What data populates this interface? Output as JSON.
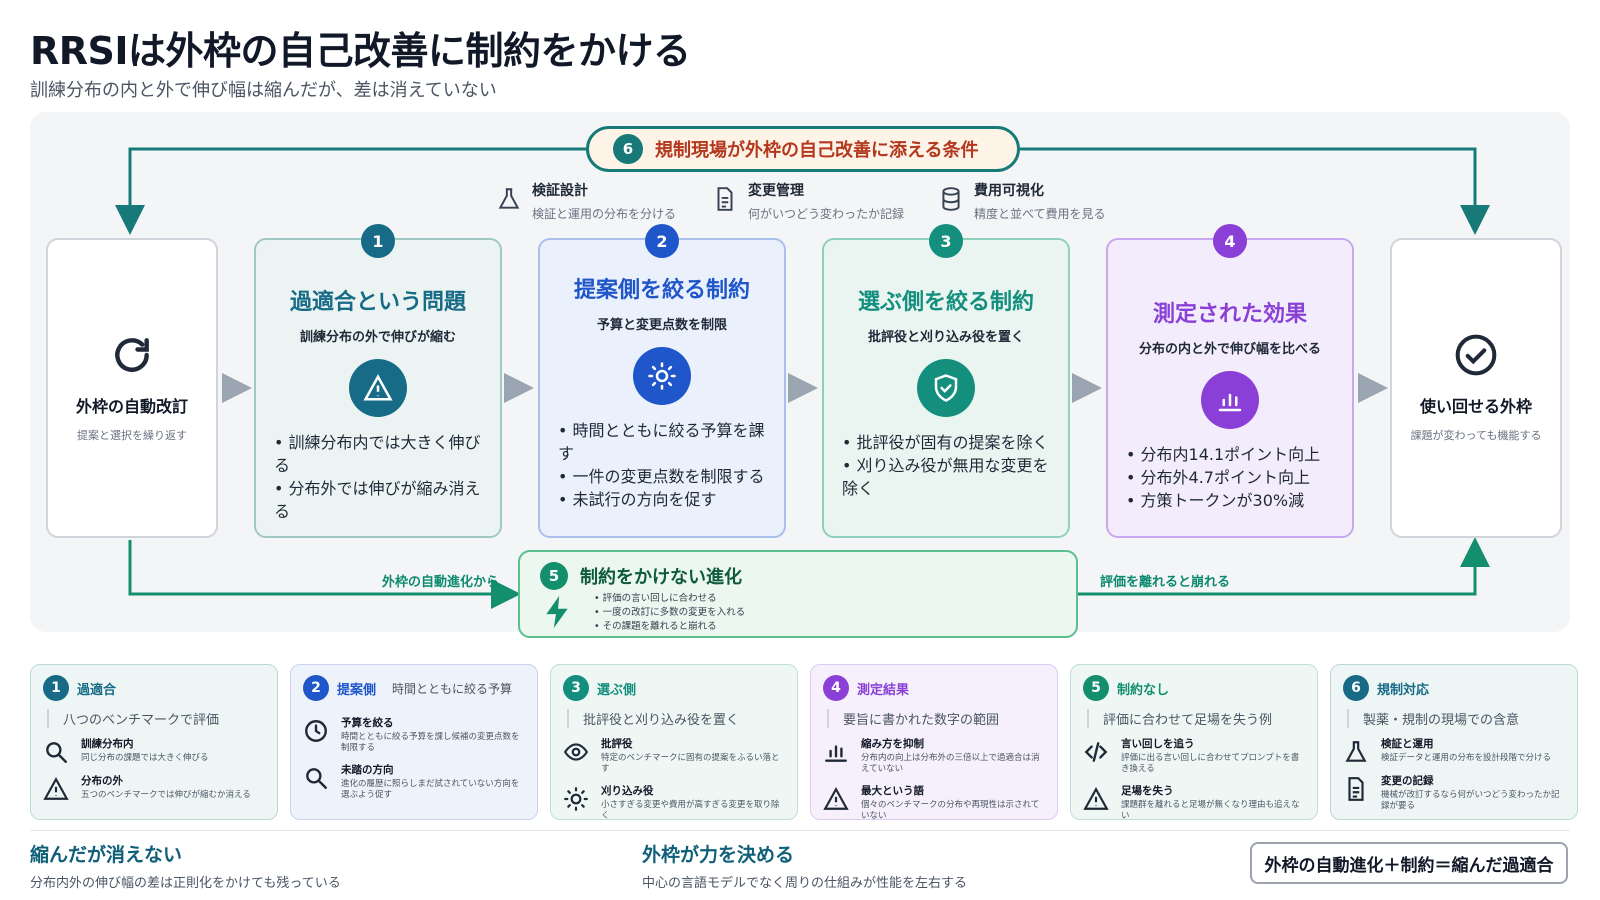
{
  "header": {
    "title": "RRSIは外枠の自己改善に制約をかける",
    "subtitle": "訓練分布の内と外で伸び幅は縮んだが、差は消えていない"
  },
  "banner": {
    "num": "6",
    "label": "規制現場が外枠の自己改善に添える条件"
  },
  "tools": [
    {
      "title": "検証設計",
      "desc": "検証と運用の分布を分ける",
      "icon": "flask-icon"
    },
    {
      "title": "変更管理",
      "desc": "何がいつどう変わったか記録",
      "icon": "document-icon"
    },
    {
      "title": "費用可視化",
      "desc": "精度と並べて費用を見る",
      "icon": "database-icon"
    }
  ],
  "left_node": {
    "title": "外枠の自動改訂",
    "desc": "提案と選択を繰り返す",
    "icon": "refresh-icon"
  },
  "right_node": {
    "title": "使い回せる外枠",
    "desc": "課題が変わっても機能する",
    "icon": "check-circle-icon"
  },
  "cards": [
    {
      "num": "1",
      "title": "過適合という問題",
      "subtitle": "訓練分布の外で伸びが縮む",
      "icon": "warning-icon",
      "color": "#176b87",
      "bullets": [
        "訓練分布内では大きく伸びる",
        "分布外では伸びが縮み消える"
      ]
    },
    {
      "num": "2",
      "title": "提案側を絞る制約",
      "subtitle": "予算と変更点数を制限",
      "icon": "sun-icon",
      "color": "#1f56c9",
      "bullets": [
        "時間とともに絞る予算を課す",
        "一件の変更点数を制限する",
        "未試行の方向を促す"
      ]
    },
    {
      "num": "3",
      "title": "選ぶ側を絞る制約",
      "subtitle": "批評役と刈り込み役を置く",
      "icon": "shield-check-icon",
      "color": "#148f7e",
      "bullets": [
        "批評役が固有の提案を除く",
        "刈り込み役が無用な変更を除く"
      ]
    },
    {
      "num": "4",
      "title": "測定された効果",
      "subtitle": "分布の内と外で伸び幅を比べる",
      "icon": "bar-chart-icon",
      "color": "#8a3fd6",
      "bullets": [
        "分布内14.1ポイント向上",
        "分布外4.7ポイント向上",
        "方策トークンが30%減"
      ]
    }
  ],
  "unconstrained": {
    "num": "5",
    "title": "制約をかけない進化",
    "icon": "bolt-icon",
    "bullets": [
      "評価の言い回しに合わせる",
      "一度の改訂に多数の変更を入れる",
      "その課題を離れると崩れる"
    ],
    "in_label": "外枠の自動進化から",
    "out_label": "評価を離れると崩れる"
  },
  "legend": [
    {
      "num": "1",
      "title": "過適合",
      "title2": "",
      "sub": "八つのベンチマークで評価",
      "color": "#176b87",
      "bg": "#eef6f5",
      "border": "#bcd9d6",
      "items": [
        {
          "icon": "search-icon",
          "a": "訓練分布内",
          "b": "同じ分布の課題では大きく伸びる"
        },
        {
          "icon": "warning-icon",
          "a": "分布の外",
          "b": "五つのベンチマークでは伸びが縮むか消える"
        }
      ]
    },
    {
      "num": "2",
      "title": "提案側",
      "title2": "時間とともに絞る予算",
      "sub": "",
      "color": "#1f56c9",
      "bg": "#eef2fb",
      "border": "#c6d2ee",
      "items": [
        {
          "icon": "clock-icon",
          "a": "予算を絞る",
          "b": "時間とともに絞る予算を課し候補の変更点数を制限する"
        },
        {
          "icon": "search-icon",
          "a": "未踏の方向",
          "b": "進化の履歴に照らしまだ試されていない方向を選ぶよう促す"
        }
      ]
    },
    {
      "num": "3",
      "title": "選ぶ側",
      "title2": "",
      "sub": "批評役と刈り込み役を置く",
      "color": "#148f7e",
      "bg": "#eef7f3",
      "border": "#bfe0d4",
      "items": [
        {
          "icon": "eye-icon",
          "a": "批評役",
          "b": "特定のベンチマークに固有の提案をふるい落とす"
        },
        {
          "icon": "sun-icon",
          "a": "刈り込み役",
          "b": "小さすぎる変更や費用が高すぎる変更を取り除く"
        }
      ]
    },
    {
      "num": "4",
      "title": "測定結果",
      "title2": "",
      "sub": "要旨に書かれた数字の範囲",
      "color": "#8a3fd6",
      "bg": "#f5f0fc",
      "border": "#dccbf2",
      "items": [
        {
          "icon": "bar-chart-icon",
          "a": "縮み方を抑制",
          "b": "分布内の向上は分布外の三倍以上で過適合は消えていない"
        },
        {
          "icon": "warning-icon",
          "a": "最大という語",
          "b": "個々のベンチマークの分布や再現性は示されていない"
        }
      ]
    },
    {
      "num": "5",
      "title": "制約なし",
      "title2": "",
      "sub": "評価に合わせて足場を失う例",
      "color": "#148f6e",
      "bg": "#eef7f3",
      "border": "#bfe0d4",
      "items": [
        {
          "icon": "code-icon",
          "a": "言い回しを追う",
          "b": "評価に出る言い回しに合わせてプロンプトを書き換える"
        },
        {
          "icon": "warning-icon",
          "a": "足場を失う",
          "b": "課題群を離れると足場が無くなり理由も追えない"
        }
      ]
    },
    {
      "num": "6",
      "title": "規制対応",
      "title2": "",
      "sub": "製薬・規制の現場での含意",
      "color": "#176b87",
      "bg": "#eef6f5",
      "border": "#bcd9d6",
      "items": [
        {
          "icon": "flask-icon",
          "a": "検証と運用",
          "b": "検証データと運用の分布を設計段階で分ける"
        },
        {
          "icon": "document-icon",
          "a": "変更の記録",
          "b": "機械が改訂するなら何がいつどう変わったか記録が要る"
        }
      ]
    }
  ],
  "footer": {
    "left_title": "縮んだが消えない",
    "left_desc": "分布内外の伸び幅の差は正則化をかけても残っている",
    "mid_title": "外枠が力を決める",
    "mid_desc": "中心の言語モデルでなく周りの仕組みが性能を左右する",
    "formula": "外枠の自動進化＋制約＝縮んだ過適合"
  }
}
